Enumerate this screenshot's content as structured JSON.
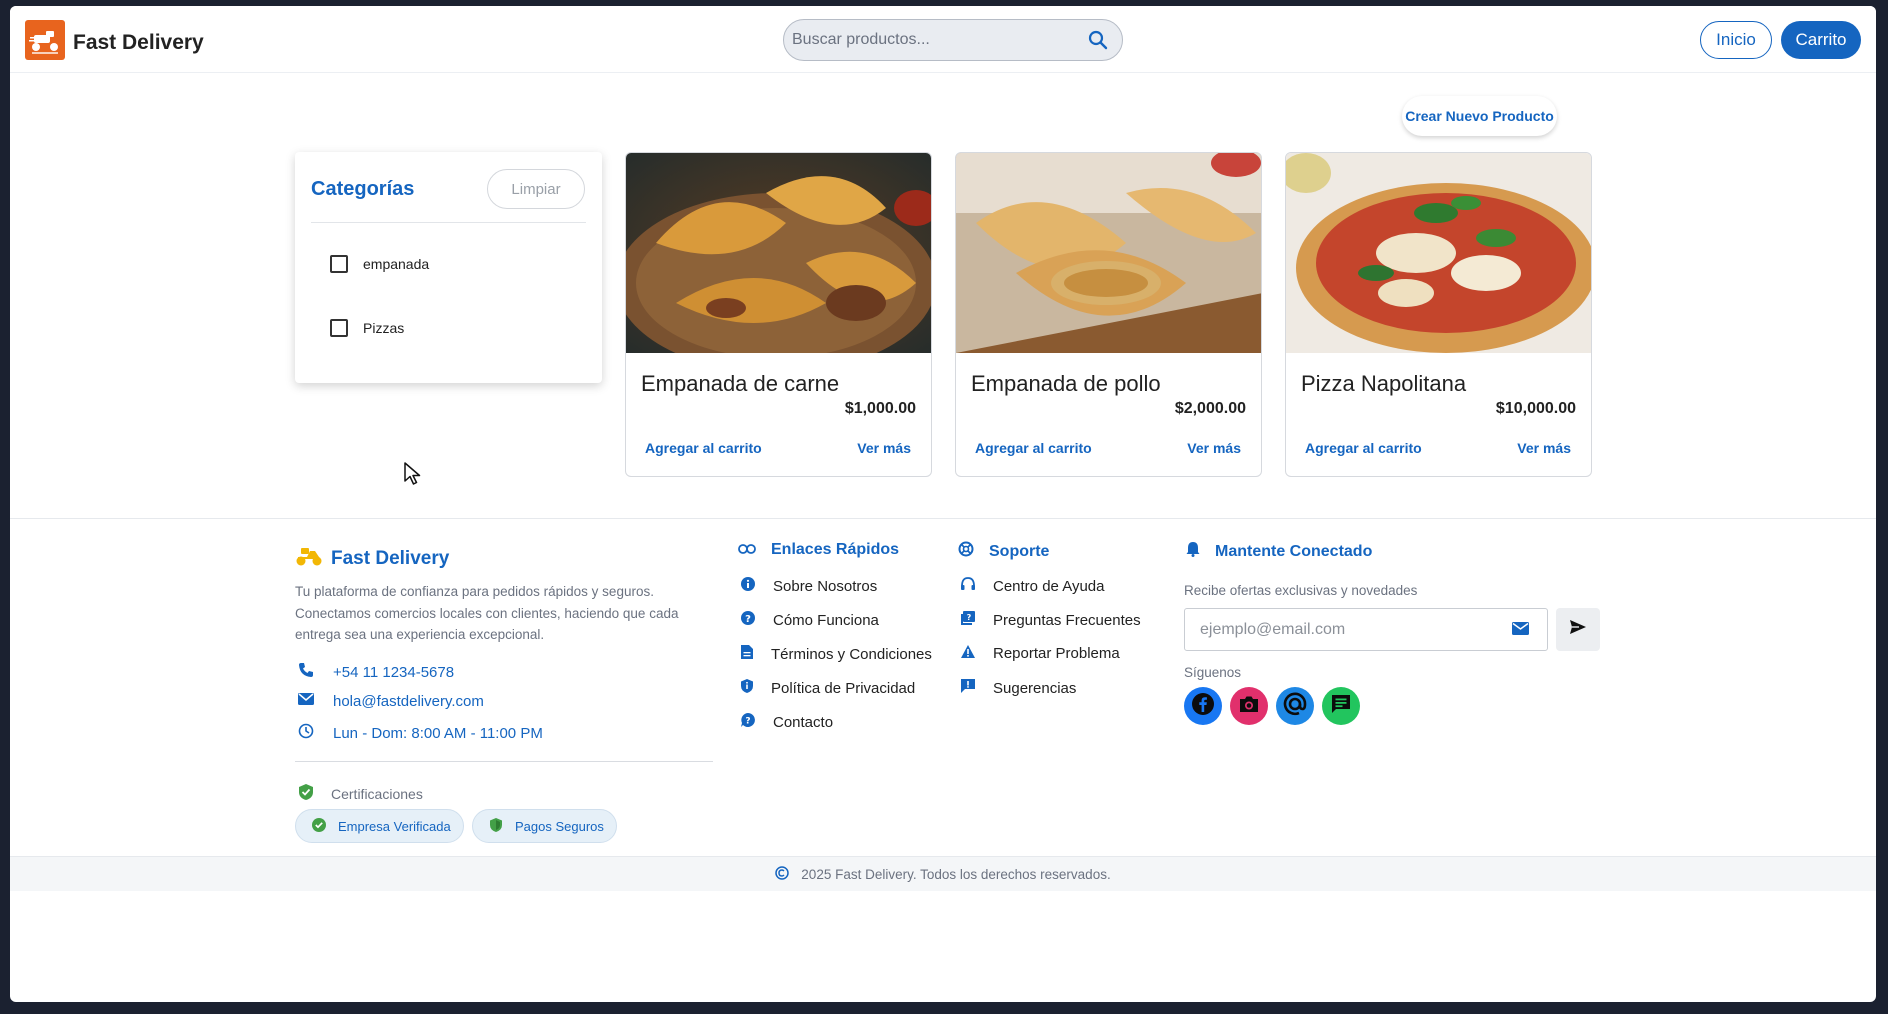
{
  "header": {
    "app_title": "Fast Delivery",
    "logo_icon": "delivery-scooter-logo",
    "search_placeholder": "Buscar productos...",
    "nav_home": "Inicio",
    "nav_cart": "Carrito",
    "accent_color": "#1565c0"
  },
  "actions": {
    "create_product": "Crear Nuevo Producto"
  },
  "categories": {
    "title": "Categorías",
    "clear_label": "Limpiar",
    "items": [
      {
        "label": "empanada",
        "checked": false
      },
      {
        "label": "Pizzas",
        "checked": false
      }
    ]
  },
  "products": [
    {
      "name": "Empanada de carne",
      "price": "$1,000.00",
      "add_label": "Agregar al carrito",
      "more_label": "Ver más",
      "image": "empanada-carne-photo"
    },
    {
      "name": "Empanada de pollo",
      "price": "$2,000.00",
      "add_label": "Agregar al carrito",
      "more_label": "Ver más",
      "image": "empanada-pollo-photo"
    },
    {
      "name": "Pizza Napolitana",
      "price": "$10,000.00",
      "add_label": "Agregar al carrito",
      "more_label": "Ver más",
      "image": "pizza-napolitana-photo"
    }
  ],
  "footer": {
    "brand": "Fast Delivery",
    "description": "Tu plataforma de confianza para pedidos rápidos y seguros. Conectamos comercios locales con clientes, haciendo que cada entrega sea una experiencia excepcional.",
    "phone": "+54 11 1234-5678",
    "email": "hola@fastdelivery.com",
    "hours": "Lun - Dom: 8:00 AM - 11:00 PM",
    "certifications_label": "Certificaciones",
    "cert_chips": [
      "Empresa Verificada",
      "Pagos Seguros"
    ],
    "quick_links": {
      "title": "Enlaces Rápidos",
      "items": [
        "Sobre Nosotros",
        "Cómo Funciona",
        "Términos y Condiciones",
        "Política de Privacidad",
        "Contacto"
      ]
    },
    "support": {
      "title": "Soporte",
      "items": [
        "Centro de Ayuda",
        "Preguntas Frecuentes",
        "Reportar Problema",
        "Sugerencias"
      ]
    },
    "newsletter": {
      "title": "Mantente Conectado",
      "description": "Recibe ofertas exclusivas y novedades",
      "email_placeholder": "ejemplo@email.com",
      "follow_label": "Síguenos",
      "social": [
        {
          "name": "facebook",
          "color": "#1877f2"
        },
        {
          "name": "instagram",
          "color": "#e1306c"
        },
        {
          "name": "email",
          "color": "#1e88e5"
        },
        {
          "name": "chat",
          "color": "#22c55e"
        }
      ]
    },
    "copyright": "2025 Fast Delivery. Todos los derechos reservados."
  }
}
